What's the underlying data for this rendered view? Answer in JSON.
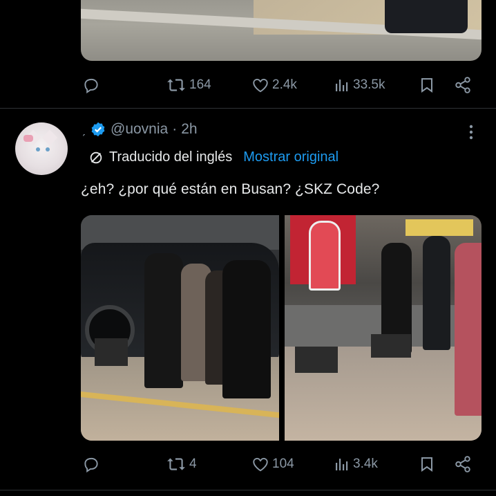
{
  "previous_tweet": {
    "actions": {
      "reply_count": "",
      "retweet_count": "164",
      "like_count": "2.4k",
      "views_count": "33.5k"
    }
  },
  "tweet": {
    "handle": "@uovnia",
    "separator": "·",
    "time": "2h",
    "translation": {
      "label": "Traducido del inglés",
      "show_original": "Mostrar original"
    },
    "text": "¿eh? ¿por qué están en Busan? ¿SKZ Code?",
    "media": {
      "left_image": "group-of-people-by-black-car",
      "right_image": "people-walking-on-street"
    },
    "actions": {
      "reply_count": "",
      "retweet_count": "4",
      "like_count": "104",
      "views_count": "3.4k"
    }
  },
  "colors": {
    "background": "#000000",
    "text": "#e7e9ea",
    "muted": "#8b98a5",
    "accent": "#1d9bf0",
    "divider": "#2f3336"
  }
}
